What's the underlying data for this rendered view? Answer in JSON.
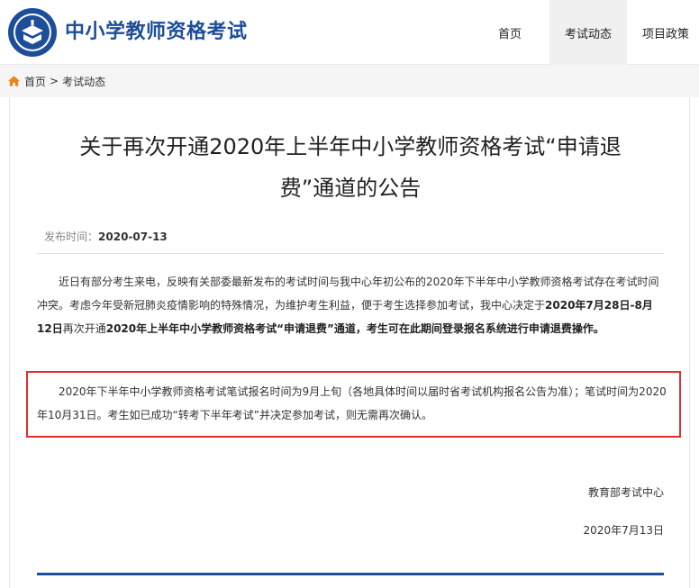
{
  "header": {
    "site_title": "中小学教师资格考试",
    "nav": [
      {
        "label": "首页",
        "active": false
      },
      {
        "label": "考试动态",
        "active": true
      },
      {
        "label": "项目政策",
        "active": false
      }
    ]
  },
  "breadcrumb": {
    "home": "首页",
    "separator": ">",
    "current": "考试动态"
  },
  "article": {
    "title": "关于再次开通2020年上半年中小学教师资格考试“申请退费”通道的公告",
    "meta_label": "发布时间：",
    "meta_date": "2020-07-13",
    "p1_a": "近日有部分考生来电，反映有关部委最新发布的考试时间与我中心年初公布的2020年下半年中小学教师资格考试存在考试时间冲突。考虑今年受新冠肺炎疫情影响的特殊情况，为维护考生利益，便于考生选择参加考试，我中心决定于",
    "p1_b": "2020年7月28日-8月12日",
    "p1_c": "再次开通",
    "p1_d": "2020年上半年中小学教师资格考试“申请退费”通道，考生可在此期间登录报名系统进行申请退费操作。",
    "p2": "2020年下半年中小学教师资格考试笔试报名时间为9月上旬（各地具体时间以届时省考试机构报名公告为准）；笔试时间为2020年10月31日。考生如已成功“转考下半年考试”并决定参加考试，则无需再次确认。",
    "signature": "教育部考试中心",
    "sign_date": "2020年7月13日"
  },
  "colors": {
    "brand": "#1d4e9a",
    "highlight_border": "#e0302f"
  }
}
